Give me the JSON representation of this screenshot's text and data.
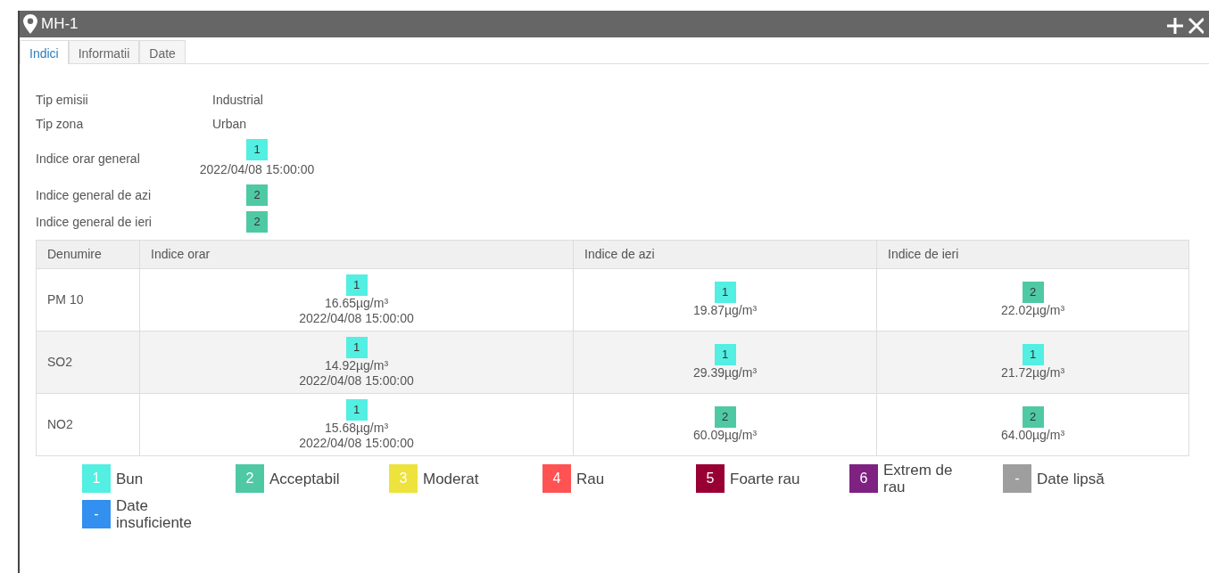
{
  "window": {
    "title": "MH-1"
  },
  "tabs": [
    {
      "label": "Indici",
      "selected": true
    },
    {
      "label": "Informatii",
      "selected": false
    },
    {
      "label": "Date",
      "selected": false
    }
  ],
  "details": [
    {
      "label": "Tip emisii",
      "kind": "text",
      "value": "Industrial"
    },
    {
      "label": "Tip zona",
      "kind": "text",
      "value": "Urban"
    },
    {
      "label": "Indice orar general",
      "kind": "index",
      "index": "1",
      "color": "#52efe2",
      "time": "2022/04/08 15:00:00"
    },
    {
      "label": "Indice general de azi",
      "kind": "index",
      "index": "2",
      "color": "#4fc9a4"
    },
    {
      "label": "Indice general de ieri",
      "kind": "index",
      "index": "2",
      "color": "#4fc9a4"
    }
  ],
  "table": {
    "columns": [
      "Denumire",
      "Indice orar",
      "Indice de azi",
      "Indice de ieri"
    ],
    "rows": [
      {
        "cells": [
          {
            "kind": "name",
            "text": "PM 10"
          },
          {
            "kind": "index",
            "index": "1",
            "color": "#52efe2",
            "value": "16.65µg/m³",
            "time": "2022/04/08 15:00:00"
          },
          {
            "kind": "index",
            "index": "1",
            "color": "#52efe2",
            "value": "19.87µg/m³"
          },
          {
            "kind": "index",
            "index": "2",
            "color": "#4fc9a4",
            "value": "22.02µg/m³"
          }
        ]
      },
      {
        "cells": [
          {
            "kind": "name",
            "text": "SO2"
          },
          {
            "kind": "index",
            "index": "1",
            "color": "#52efe2",
            "value": "14.92µg/m³",
            "time": "2022/04/08 15:00:00"
          },
          {
            "kind": "index",
            "index": "1",
            "color": "#52efe2",
            "value": "29.39µg/m³"
          },
          {
            "kind": "index",
            "index": "1",
            "color": "#52efe2",
            "value": "21.72µg/m³"
          }
        ]
      },
      {
        "cells": [
          {
            "kind": "name",
            "text": "NO2"
          },
          {
            "kind": "index",
            "index": "1",
            "color": "#52efe2",
            "value": "15.68µg/m³",
            "time": "2022/04/08 15:00:00"
          },
          {
            "kind": "index",
            "index": "2",
            "color": "#4fc9a4",
            "value": "60.09µg/m³"
          },
          {
            "kind": "index",
            "index": "2",
            "color": "#4fc9a4",
            "value": "64.00µg/m³"
          }
        ]
      }
    ]
  },
  "legend": [
    {
      "index": "1",
      "label": "Bun",
      "color": "#52efe2"
    },
    {
      "index": "2",
      "label": "Acceptabil",
      "color": "#4fc9a4"
    },
    {
      "index": "3",
      "label": "Moderat",
      "color": "#ede33c"
    },
    {
      "index": "4",
      "label": "Rau",
      "color": "#ff5252"
    },
    {
      "index": "5",
      "label": "Foarte rau",
      "color": "#980033"
    },
    {
      "index": "6",
      "label": "Extrem de rau",
      "color": "#7e2181"
    },
    {
      "index": "-",
      "label": "Date lipsă",
      "color": "#9e9e9e"
    },
    {
      "index": "-",
      "label": "Date insuficiente",
      "color": "#338ff0"
    }
  ]
}
